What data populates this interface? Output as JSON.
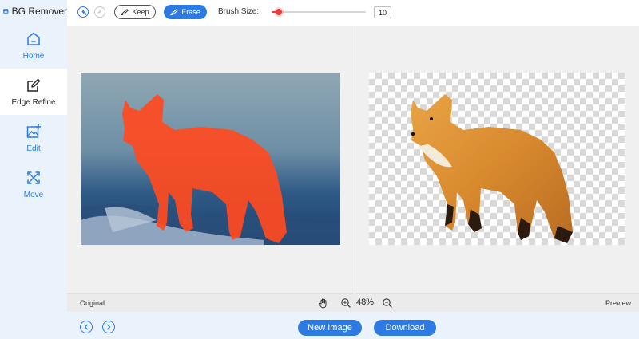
{
  "app": {
    "title": "BG Remover"
  },
  "sidebar": {
    "items": [
      {
        "label": "Home",
        "icon": "home-icon"
      },
      {
        "label": "Edge Refine",
        "icon": "edge-refine-icon",
        "active": true
      },
      {
        "label": "Edit",
        "icon": "image-edit-icon"
      },
      {
        "label": "Move",
        "icon": "move-icon"
      }
    ]
  },
  "toolbar": {
    "keep_label": "Keep",
    "erase_label": "Erase",
    "brush_label": "Brush Size:",
    "brush_value": "10",
    "brush_fraction": 0.08
  },
  "status": {
    "left_label": "Original",
    "right_label": "Preview",
    "zoom": "48%"
  },
  "actions": {
    "new_image": "New Image",
    "download": "Download"
  },
  "colors": {
    "accent": "#2d7be2",
    "sidebar_bg": "#eaf3fc",
    "slider_active": "#ef3b3b",
    "mask_overlay": "#ff4a1f"
  }
}
